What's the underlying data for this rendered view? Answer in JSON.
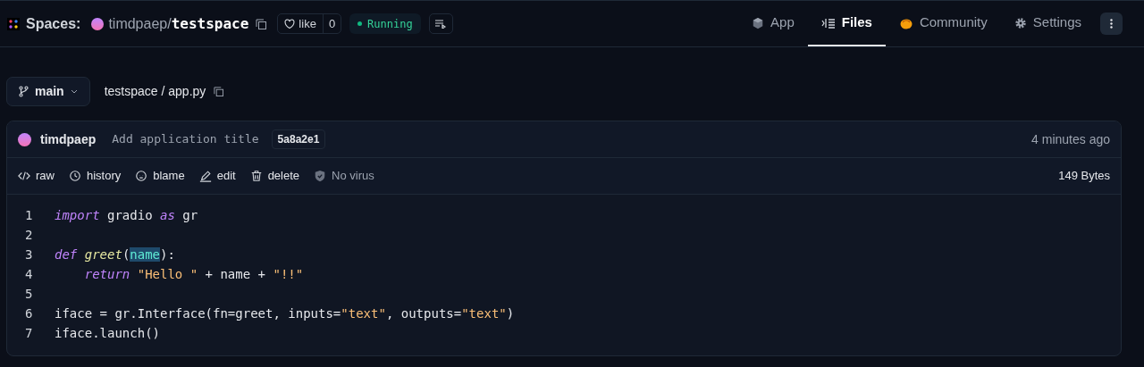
{
  "header": {
    "brand": "Spaces:",
    "owner": "timdpaep",
    "separator": "/",
    "repo": "testspace",
    "like": {
      "label": "like",
      "count": "0",
      "liked": false
    },
    "status": {
      "label": "Running",
      "running": true
    },
    "tabs": [
      {
        "label": "App",
        "selected": false
      },
      {
        "label": "Files",
        "selected": true
      },
      {
        "label": "Community",
        "selected": false
      },
      {
        "label": "Settings",
        "selected": false
      }
    ]
  },
  "branch": "main",
  "path": "testspace / app.py",
  "commit": {
    "author": "timdpaep",
    "message": "Add application title",
    "hash": "5a8a2e1",
    "time": "4 minutes ago"
  },
  "actions": [
    {
      "label": "raw"
    },
    {
      "label": "history"
    },
    {
      "label": "blame"
    },
    {
      "label": "edit"
    },
    {
      "label": "delete"
    }
  ],
  "scan": "No virus",
  "size": "149 Bytes",
  "code": [
    {
      "number": "1",
      "tokens": [
        {
          "kind": "kw",
          "text": "import"
        },
        {
          "kind": "plain",
          "text": " gradio "
        },
        {
          "kind": "kw",
          "text": "as"
        },
        {
          "kind": "plain",
          "text": " gr"
        }
      ]
    },
    {
      "number": "2"
    },
    {
      "number": "3",
      "tokens": [
        {
          "kind": "kw",
          "text": "def"
        },
        {
          "kind": "fn",
          "text": " greet"
        },
        {
          "kind": "plain",
          "text": "("
        },
        {
          "kind": "match",
          "text": "name"
        },
        {
          "kind": "plain",
          "text": "):"
        }
      ]
    },
    {
      "number": "4",
      "tokens": [
        {
          "kind": "kw",
          "text": "    return"
        },
        {
          "kind": "str",
          "text": " \"Hello \""
        },
        {
          "kind": "plain",
          "text": " + name + "
        },
        {
          "kind": "str",
          "text": "\"!!\""
        }
      ]
    },
    {
      "number": "5"
    },
    {
      "number": "6",
      "tokens": [
        {
          "kind": "plain",
          "text": "iface = gr.Interface(fn=greet, inputs="
        },
        {
          "kind": "str",
          "text": "\"text\""
        },
        {
          "kind": "plain",
          "text": ", outputs="
        },
        {
          "kind": "str",
          "text": "\"text\""
        },
        {
          "kind": "plain",
          "text": ")"
        }
      ]
    },
    {
      "number": "7",
      "tokens": [
        {
          "kind": "plain",
          "text": "iface.launch()"
        }
      ]
    }
  ]
}
